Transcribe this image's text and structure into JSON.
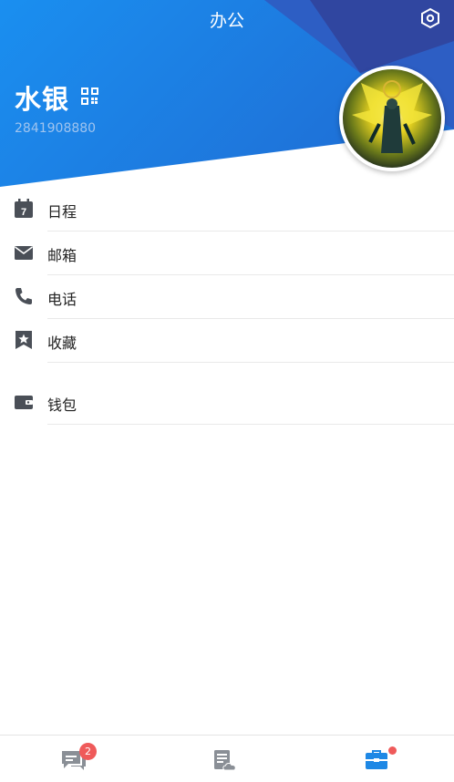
{
  "header": {
    "title": "办公",
    "settings_icon": "settings-hexagon-icon"
  },
  "profile": {
    "name": "水银",
    "id": "2841908880",
    "qr_icon": "qr-code-icon"
  },
  "menu": {
    "items": [
      {
        "label": "日程",
        "icon": "calendar-icon",
        "calendar_day": "7"
      },
      {
        "label": "邮箱",
        "icon": "mail-icon"
      },
      {
        "label": "电话",
        "icon": "phone-icon"
      },
      {
        "label": "收藏",
        "icon": "bookmark-star-icon"
      },
      {
        "label": "钱包",
        "icon": "wallet-icon"
      }
    ]
  },
  "tabbar": {
    "tabs": [
      {
        "name": "messages",
        "icon": "chat-icon",
        "badge": "2"
      },
      {
        "name": "documents",
        "icon": "cloud-doc-icon"
      },
      {
        "name": "office",
        "icon": "briefcase-icon",
        "active": true
      }
    ]
  },
  "colors": {
    "header_blue": "#1b84e8",
    "header_dark": "#2f4fa8",
    "icon_gray": "#4a4f57",
    "accent": "#1e88e5",
    "badge": "#ef5a5a"
  }
}
